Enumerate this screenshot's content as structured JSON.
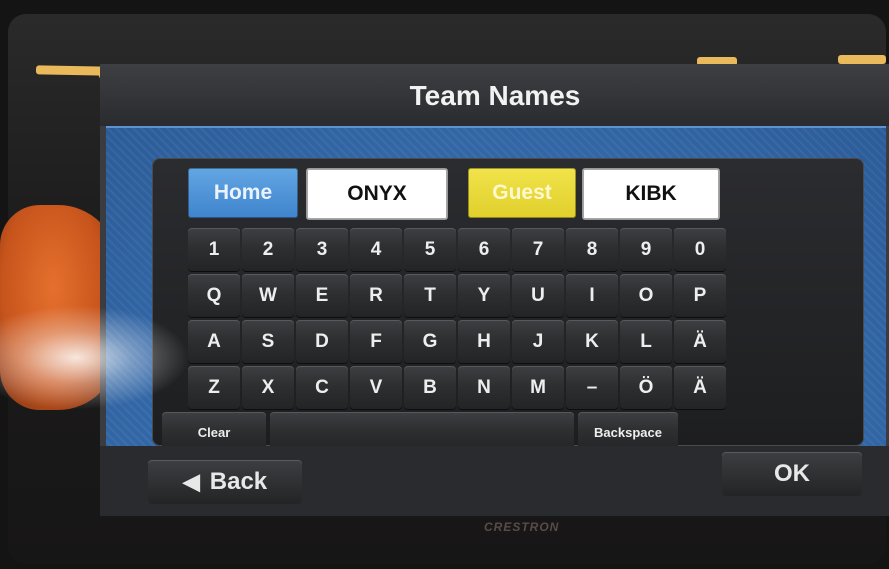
{
  "title": "Team Names",
  "teams": {
    "home_label": "Home",
    "home_name": "ONYX",
    "guest_label": "Guest",
    "guest_name": "KIBK"
  },
  "keyboard": {
    "row1": [
      "1",
      "2",
      "3",
      "4",
      "5",
      "6",
      "7",
      "8",
      "9",
      "0"
    ],
    "row2": [
      "Q",
      "W",
      "E",
      "R",
      "T",
      "Y",
      "U",
      "I",
      "O",
      "P"
    ],
    "row3": [
      "A",
      "S",
      "D",
      "F",
      "G",
      "H",
      "J",
      "K",
      "L",
      "Ä"
    ],
    "row4": [
      "Z",
      "X",
      "C",
      "V",
      "B",
      "N",
      "M",
      "–",
      "Ö",
      "Ä"
    ],
    "clear": "Clear",
    "backspace": "Backspace"
  },
  "nav": {
    "back": "Back",
    "ok": "OK"
  },
  "brand": "CRESTRON",
  "colors": {
    "home": "#3f84cc",
    "guest": "#e0cf2c",
    "panel": "#346aab"
  }
}
